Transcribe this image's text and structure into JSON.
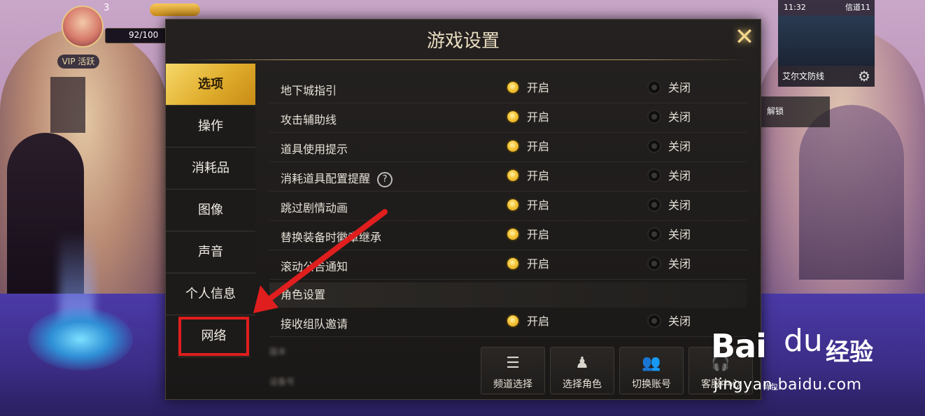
{
  "hud": {
    "level": "3",
    "hp": "92/100",
    "badge": "VIP 活跃",
    "time": "11:32",
    "network": "信道11",
    "map_name": "艾尔文防线",
    "side_label": "解锁",
    "bottom_labels": [
      "背包"
    ]
  },
  "dialog": {
    "title": "游戏设置",
    "close_label": "✕"
  },
  "menu": [
    {
      "id": "options",
      "label": "选项",
      "active": true
    },
    {
      "id": "controls",
      "label": "操作",
      "active": false
    },
    {
      "id": "consumables",
      "label": "消耗品",
      "active": false
    },
    {
      "id": "graphics",
      "label": "图像",
      "active": false
    },
    {
      "id": "sound",
      "label": "声音",
      "active": false
    },
    {
      "id": "profile",
      "label": "个人信息",
      "active": false
    },
    {
      "id": "network",
      "label": "网络",
      "active": false
    }
  ],
  "options": {
    "on_label": "开启",
    "off_label": "关闭",
    "rows": [
      {
        "label": "地下城指引",
        "value": "on"
      },
      {
        "label": "攻击辅助线",
        "value": "on"
      },
      {
        "label": "道具使用提示",
        "value": "on"
      },
      {
        "label": "消耗道具配置提醒",
        "value": "on",
        "help": "?"
      },
      {
        "label": "跳过剧情动画",
        "value": "on"
      },
      {
        "label": "替换装备时徽章继承",
        "value": "on"
      },
      {
        "label": "滚动公告通知",
        "value": "on"
      }
    ],
    "section_title": "角色设置",
    "section_rows": [
      {
        "label": "接收组队邀请",
        "value": "on"
      }
    ]
  },
  "info": {
    "version_label": "版本",
    "device_label": "设备号"
  },
  "actions": [
    {
      "id": "channel",
      "label": "频道选择",
      "icon": "list-icon"
    },
    {
      "id": "character",
      "label": "选择角色",
      "icon": "person-pin-icon"
    },
    {
      "id": "account",
      "label": "切换账号",
      "icon": "group-icon"
    },
    {
      "id": "service",
      "label": "客服中心",
      "icon": "headset-icon"
    }
  ],
  "watermark": {
    "brand": "Bai",
    "paw": "du",
    "cn": "经验",
    "url": "jingyan.baidu.com"
  },
  "colors": {
    "accent_gold": "#f4c437",
    "highlight_red": "#e01e1e",
    "panel_bg": "#1f1d1c"
  }
}
